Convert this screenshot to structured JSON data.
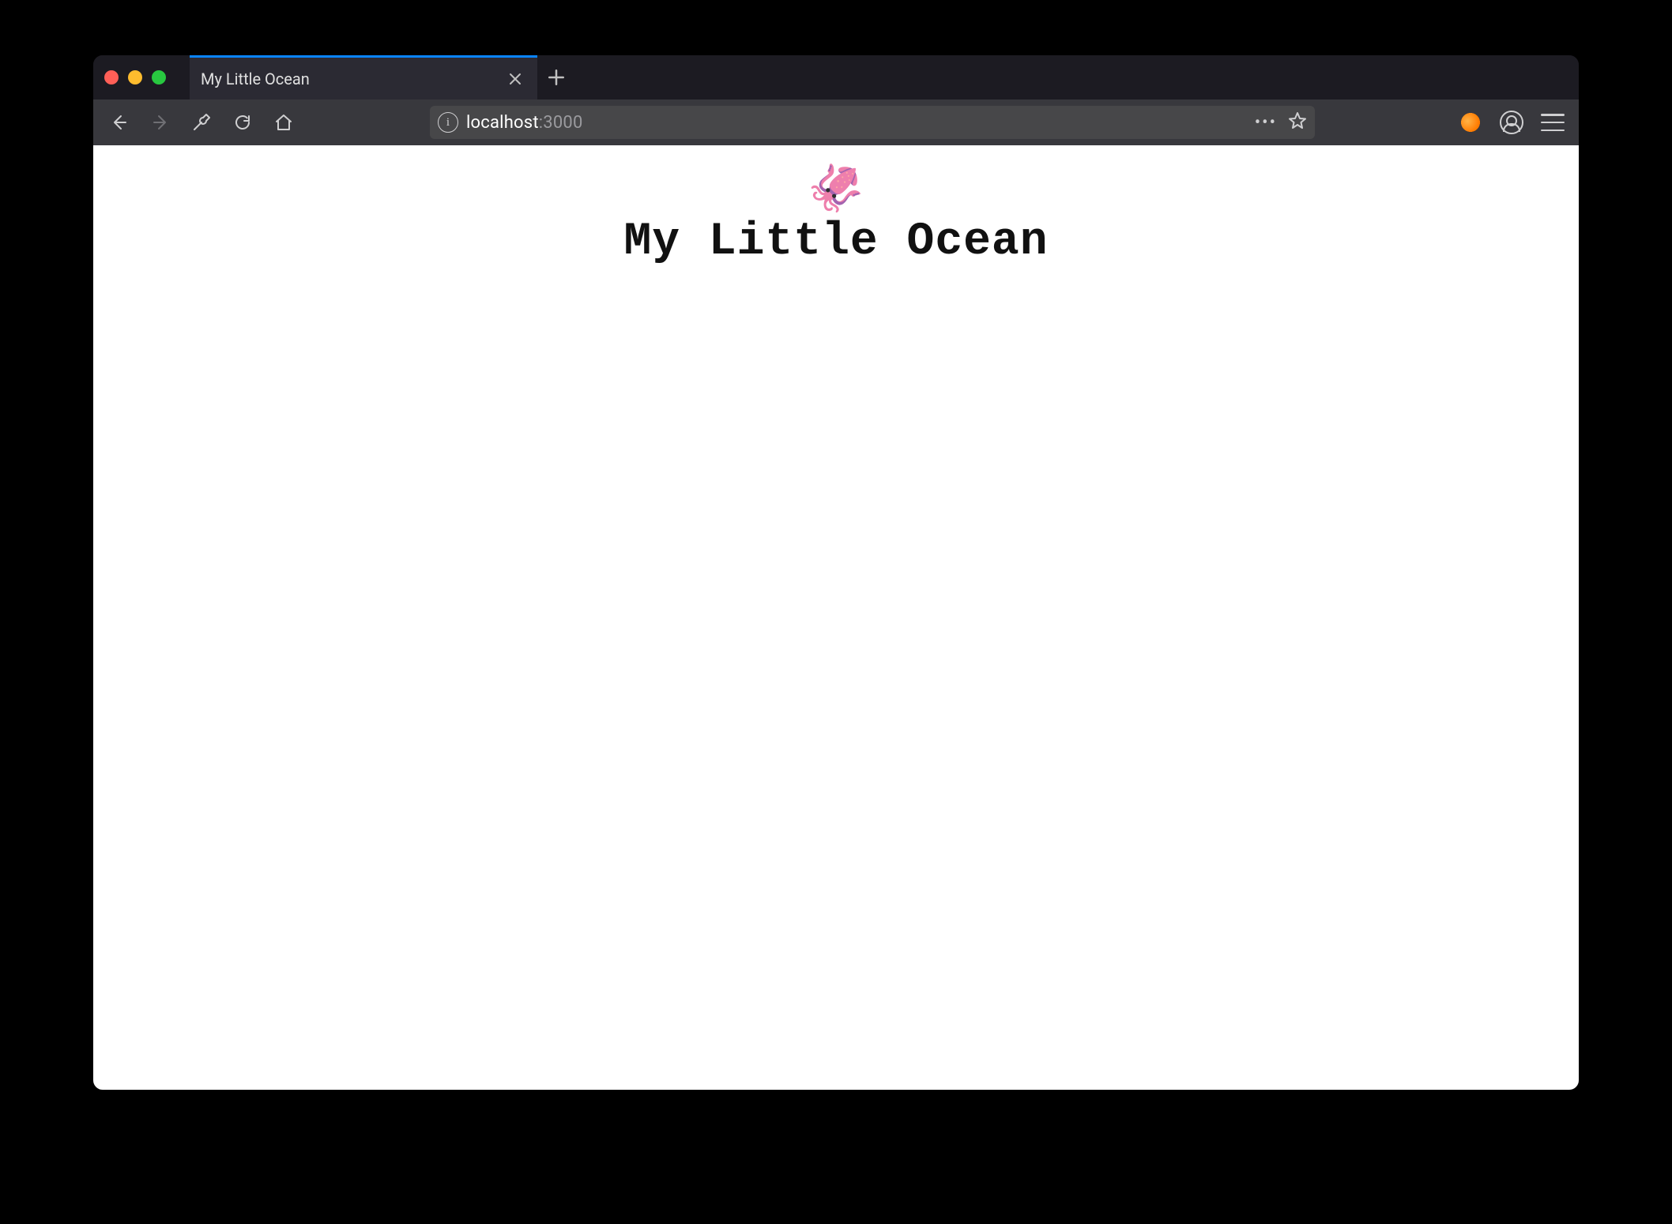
{
  "tab": {
    "title": "My Little Ocean"
  },
  "url": {
    "host": "localhost",
    "port": ":3000"
  },
  "page": {
    "emoji": "🦑",
    "heading": "My Little Ocean"
  }
}
